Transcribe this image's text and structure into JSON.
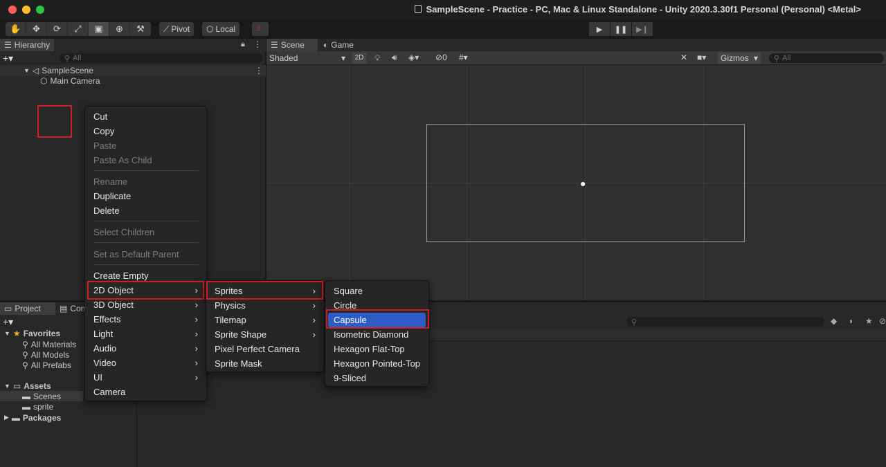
{
  "window": {
    "title": "SampleScene - Practice - PC, Mac & Linux Standalone - Unity 2020.3.30f1 Personal (Personal) <Metal>"
  },
  "toolbar": {
    "pivot_label": "Pivot",
    "local_label": "Local"
  },
  "hierarchy": {
    "tab_label": "Hierarchy",
    "search_placeholder": "All",
    "scene_name": "SampleScene",
    "items": [
      "Main Camera"
    ]
  },
  "scene_view": {
    "tabs": [
      "Scene",
      "Game"
    ],
    "shading_mode": "Shaded",
    "mode_2d_label": "2D",
    "hidden_count": "0",
    "gizmos_label": "Gizmos",
    "search_placeholder": "All"
  },
  "project": {
    "tabs": [
      "Project",
      "Con"
    ],
    "favorites_label": "Favorites",
    "favorites": [
      "All Materials",
      "All Models",
      "All Prefabs"
    ],
    "assets_label": "Assets",
    "asset_folders": [
      "Scenes",
      "sprite"
    ],
    "packages_label": "Packages"
  },
  "context_menu": {
    "items": [
      {
        "label": "Cut",
        "disabled": false
      },
      {
        "label": "Copy",
        "disabled": false
      },
      {
        "label": "Paste",
        "disabled": true
      },
      {
        "label": "Paste As Child",
        "disabled": true
      },
      {
        "label": "Rename",
        "disabled": true
      },
      {
        "label": "Duplicate",
        "disabled": false
      },
      {
        "label": "Delete",
        "disabled": false
      },
      {
        "label": "Select Children",
        "disabled": true
      },
      {
        "label": "Set as Default Parent",
        "disabled": true
      },
      {
        "label": "Create Empty",
        "disabled": false
      },
      {
        "label": "2D Object",
        "disabled": false
      },
      {
        "label": "3D Object",
        "disabled": false
      },
      {
        "label": "Effects",
        "disabled": false
      },
      {
        "label": "Light",
        "disabled": false
      },
      {
        "label": "Audio",
        "disabled": false
      },
      {
        "label": "Video",
        "disabled": false
      },
      {
        "label": "UI",
        "disabled": false
      },
      {
        "label": "Camera",
        "disabled": false
      }
    ]
  },
  "submenu_2d": {
    "items": [
      "Sprites",
      "Physics",
      "Tilemap",
      "Sprite Shape",
      "Pixel Perfect Camera",
      "Sprite Mask"
    ]
  },
  "submenu_sprites": {
    "items": [
      "Square",
      "Circle",
      "Capsule",
      "Isometric Diamond",
      "Hexagon Flat-Top",
      "Hexagon Pointed-Top",
      "9-Sliced"
    ],
    "selected": "Capsule"
  },
  "colors": {
    "highlight_box": "#d01f24",
    "selection": "#2f5cc4"
  }
}
